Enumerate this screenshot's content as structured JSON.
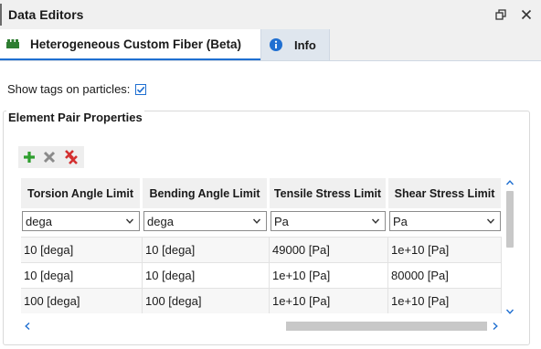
{
  "window": {
    "title": "Data Editors"
  },
  "tabs": [
    {
      "label": "Heterogeneous Custom Fiber (Beta)",
      "icon": "fiber-icon",
      "active": true
    },
    {
      "label": "Info",
      "icon": "info-icon",
      "active": false
    }
  ],
  "options": {
    "show_tags_label": "Show tags on particles:",
    "show_tags_checked": true
  },
  "group": {
    "title": "Element Pair Properties"
  },
  "toolbar": {
    "add": "add-row",
    "remove": "remove-row",
    "remove_all": "remove-all-rows"
  },
  "grid": {
    "columns": [
      {
        "header": "Torsion Angle Limit",
        "unit": "dega"
      },
      {
        "header": "Bending Angle Limit",
        "unit": "dega"
      },
      {
        "header": "Tensile Stress Limit",
        "unit": "Pa"
      },
      {
        "header": "Shear Stress Limit",
        "unit": "Pa"
      }
    ],
    "rows": [
      [
        "10 [dega]",
        "10 [dega]",
        "49000 [Pa]",
        "1e+10 [Pa]"
      ],
      [
        "10 [dega]",
        "10 [dega]",
        "1e+10 [Pa]",
        "80000 [Pa]"
      ],
      [
        "100 [dega]",
        "100 [dega]",
        "1e+10 [Pa]",
        "1e+10 [Pa]"
      ]
    ]
  },
  "colors": {
    "accent": "#1f6fd1",
    "add": "#2e9e2e",
    "remove": "#8a8a8a",
    "remove_all": "#d32f2f"
  }
}
